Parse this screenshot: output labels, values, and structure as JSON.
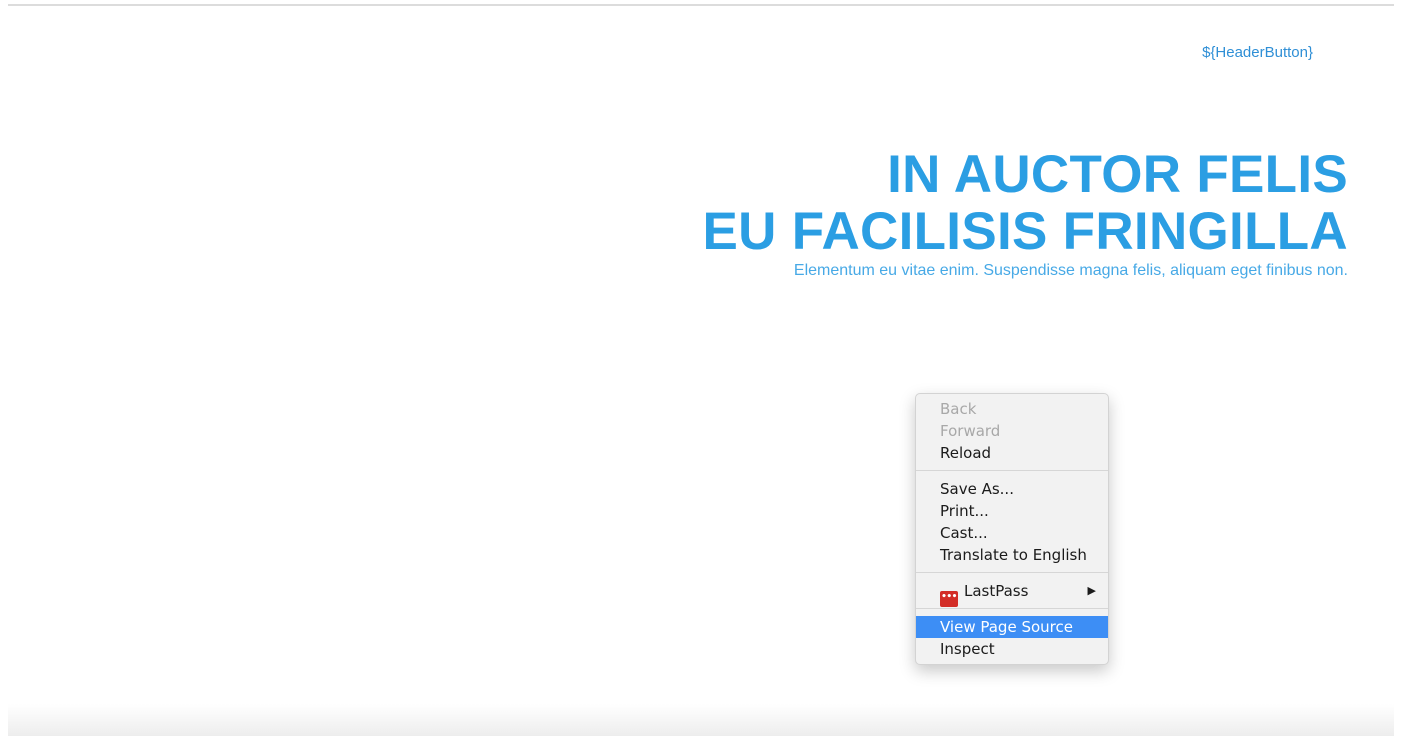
{
  "header": {
    "button_label": "${HeaderButton}"
  },
  "hero": {
    "title_line1": "IN AUCTOR FELIS",
    "title_line2": "EU FACILISIS FRINGILLA",
    "subtitle": "Elementum eu vitae enim. Suspendisse magna felis, aliquam eget finibus non."
  },
  "context_menu": {
    "back": "Back",
    "forward": "Forward",
    "reload": "Reload",
    "save_as": "Save As...",
    "print": "Print...",
    "cast": "Cast...",
    "translate": "Translate to English",
    "lastpass": "LastPass",
    "lastpass_icon": "lastpass-icon",
    "submenu_arrow": "▶",
    "view_source": "View Page Source",
    "inspect": "Inspect",
    "highlight_color": "#3d8ef5"
  },
  "colors": {
    "accent": "#2b9ee3",
    "link": "#2f8fd6"
  }
}
